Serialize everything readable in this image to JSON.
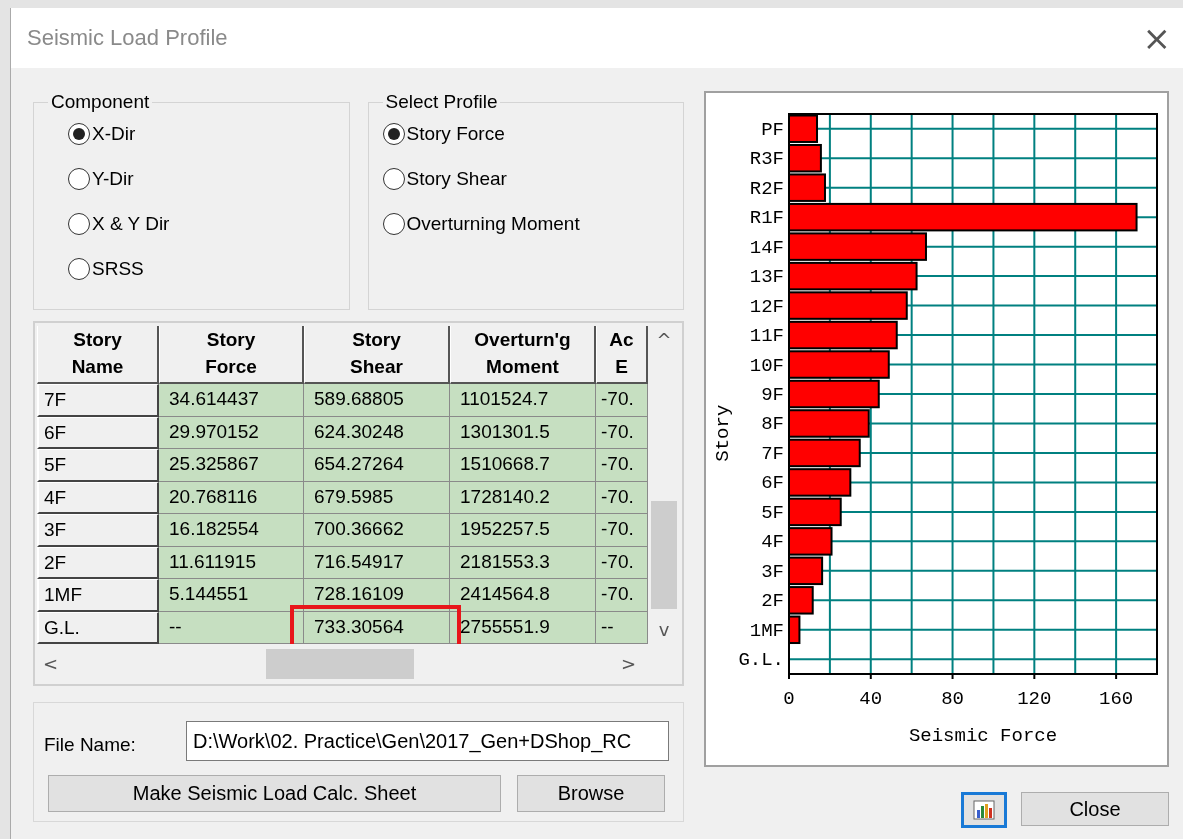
{
  "window": {
    "title": "Seismic Load Profile",
    "close_symbol": "×"
  },
  "component": {
    "label": "Component",
    "options": [
      {
        "label": "X-Dir",
        "selected": true
      },
      {
        "label": "Y-Dir",
        "selected": false
      },
      {
        "label": "X & Y Dir",
        "selected": false
      },
      {
        "label": "SRSS",
        "selected": false
      }
    ]
  },
  "select_profile": {
    "label": "Select Profile",
    "options": [
      {
        "label": "Story Force",
        "selected": true
      },
      {
        "label": "Story Shear",
        "selected": false
      },
      {
        "label": "Overturning Moment",
        "selected": false
      }
    ]
  },
  "table": {
    "columns": [
      "Story\nName",
      "Story\nForce",
      "Story\nShear",
      "Overturn'g\nMoment",
      "Ac\nE"
    ],
    "rows": [
      {
        "cells": [
          "7F",
          "34.614437",
          "589.68805",
          "1101524.7",
          "-70."
        ]
      },
      {
        "cells": [
          "6F",
          "29.970152",
          "624.30248",
          "1301301.5",
          "-70."
        ]
      },
      {
        "cells": [
          "5F",
          "25.325867",
          "654.27264",
          "1510668.7",
          "-70."
        ]
      },
      {
        "cells": [
          "4F",
          "20.768116",
          "679.5985",
          "1728140.2",
          "-70."
        ]
      },
      {
        "cells": [
          "3F",
          "16.182554",
          "700.36662",
          "1952257.5",
          "-70."
        ]
      },
      {
        "cells": [
          "2F",
          "11.611915",
          "716.54917",
          "2181553.3",
          "-70."
        ]
      },
      {
        "cells": [
          "1MF",
          "5.144551",
          "728.16109",
          "2414564.8",
          "-70."
        ]
      },
      {
        "cells": [
          "G.L.",
          "--",
          "733.30564",
          "2755551.9",
          "--"
        ],
        "shear_highlighted": true
      }
    ],
    "scroll_up": "^",
    "scroll_down": "v",
    "scroll_left": "<",
    "scroll_right": ">"
  },
  "file": {
    "label": "File Name:",
    "value": "D:\\Work\\02. Practice\\Gen\\2017_Gen+DShop_RC",
    "make_button": "Make Seismic Load Calc. Sheet",
    "browse_button": "Browse"
  },
  "chart": {
    "chart_data": {
      "type": "bar",
      "orientation": "horizontal",
      "xlabel": "Seismic Force",
      "ylabel": "Story",
      "categories": [
        "PF",
        "R3F",
        "R2F",
        "R1F",
        "14F",
        "13F",
        "12F",
        "11F",
        "10F",
        "9F",
        "8F",
        "7F",
        "6F",
        "5F",
        "4F",
        "3F",
        "2F",
        "1MF",
        "G.L."
      ],
      "series": [
        {
          "color": "#ff0000",
          "values": [
            13.7,
            15.6,
            17.6,
            170,
            67,
            62.4,
            57.6,
            52.7,
            48.8,
            43.9,
            39,
            34.6,
            30,
            25.3,
            20.8,
            16.2,
            11.6,
            5.1,
            null
          ]
        }
      ],
      "xlim": [
        0,
        180
      ],
      "xticks": [
        0,
        40,
        80,
        120,
        160
      ],
      "grid": true
    }
  },
  "close_button": "Close"
}
